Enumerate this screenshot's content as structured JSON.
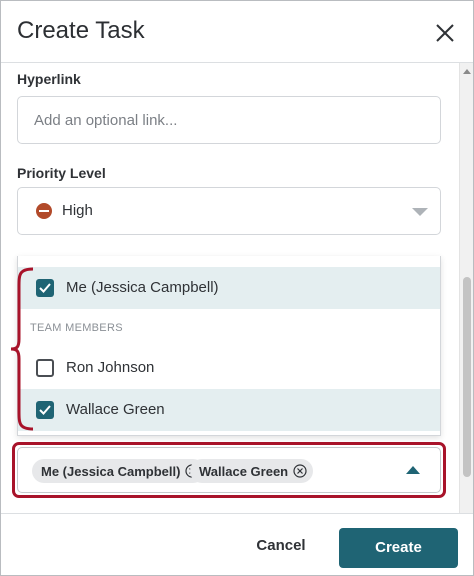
{
  "dialog": {
    "title": "Create Task",
    "close_icon": "close-icon"
  },
  "hyperlink": {
    "label": "Hyperlink",
    "placeholder": "Add an optional link..."
  },
  "priority": {
    "label": "Priority Level",
    "value": "High",
    "icon": "priority-high-icon",
    "icon_color": "#b24a2a"
  },
  "assignee_dropdown": {
    "options": [
      {
        "label": "Me (Jessica Campbell)",
        "checked": true
      },
      {
        "label": "Ron Johnson",
        "checked": false
      },
      {
        "label": "Wallace Green",
        "checked": true
      }
    ],
    "group_label": "TEAM MEMBERS"
  },
  "assignees": {
    "chips": [
      "Me (Jessica Campbell)",
      "Wallace Green"
    ]
  },
  "footer": {
    "cancel_label": "Cancel",
    "create_label": "Create"
  },
  "colors": {
    "accent": "#1f6474",
    "highlight": "#a8132a",
    "selected_row": "#e4eef0"
  }
}
